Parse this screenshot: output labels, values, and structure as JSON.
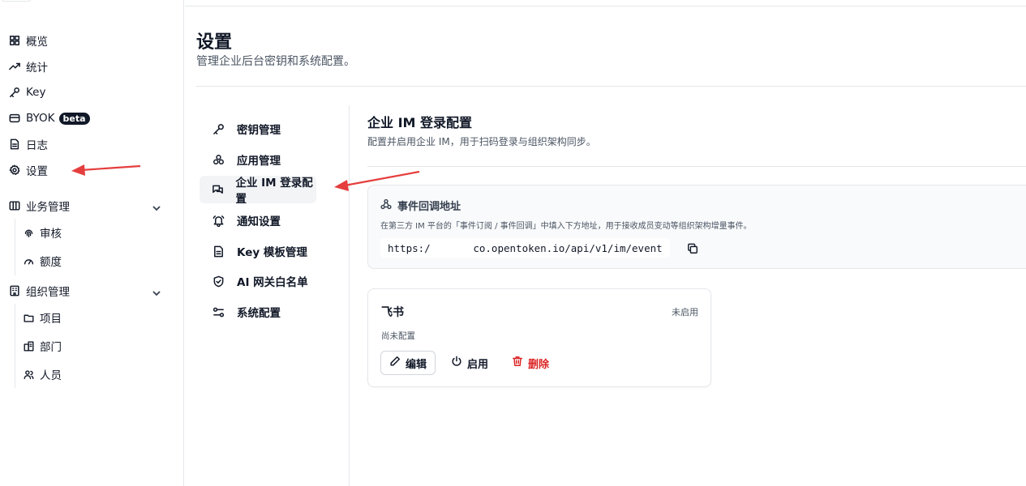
{
  "sidebar": {
    "items": [
      {
        "label": "概览",
        "icon": "grid-icon"
      },
      {
        "label": "统计",
        "icon": "trend-icon"
      },
      {
        "label": "Key",
        "icon": "key-icon"
      },
      {
        "label": "BYOK",
        "badge": "beta",
        "icon": "card-icon"
      },
      {
        "label": "日志",
        "icon": "doc-icon"
      },
      {
        "label": "设置",
        "icon": "gear-icon"
      }
    ],
    "groups": [
      {
        "label": "业务管理",
        "icon": "columns-icon",
        "children": [
          {
            "label": "审核",
            "icon": "fingerprint-icon"
          },
          {
            "label": "额度",
            "icon": "gauge-icon"
          }
        ]
      },
      {
        "label": "组织管理",
        "icon": "building-icon",
        "children": [
          {
            "label": "项目",
            "icon": "folder-icon"
          },
          {
            "label": "部门",
            "icon": "building2-icon"
          },
          {
            "label": "人员",
            "icon": "users-icon"
          }
        ]
      }
    ]
  },
  "page": {
    "title": "设置",
    "subtitle": "管理企业后台密钥和系统配置。"
  },
  "settings_nav": {
    "items": [
      {
        "label": "密钥管理",
        "icon": "key-icon"
      },
      {
        "label": "应用管理",
        "icon": "apps-icon"
      },
      {
        "label": "企业 IM 登录配置",
        "icon": "chat-icon",
        "active": true
      },
      {
        "label": "通知设置",
        "icon": "bell-icon"
      },
      {
        "label": "Key 模板管理",
        "icon": "file-icon"
      },
      {
        "label": "AI 网关白名单",
        "icon": "shield-icon"
      },
      {
        "label": "系统配置",
        "icon": "sliders-icon"
      }
    ]
  },
  "content": {
    "title": "企业 IM 登录配置",
    "subtitle": "配置并启用企业 IM，用于扫码登录与组织架构同步。",
    "callback": {
      "title": "事件回调地址",
      "description": "在第三方 IM 平台的「事件订阅 / 事件回调」中填入下方地址，用于接收成员变动等组织架构增量事件。",
      "url": "https:/       co.opentoken.io/api/v1/im/event"
    },
    "card": {
      "title": "飞书",
      "status": "未启用",
      "subtitle": "尚未配置",
      "edit_label": "编辑",
      "enable_label": "启用",
      "delete_label": "删除"
    }
  },
  "colors": {
    "accent_danger": "#dc2626",
    "annotation_arrow": "#e53e3e",
    "active_bg": "#f3f4f6"
  }
}
